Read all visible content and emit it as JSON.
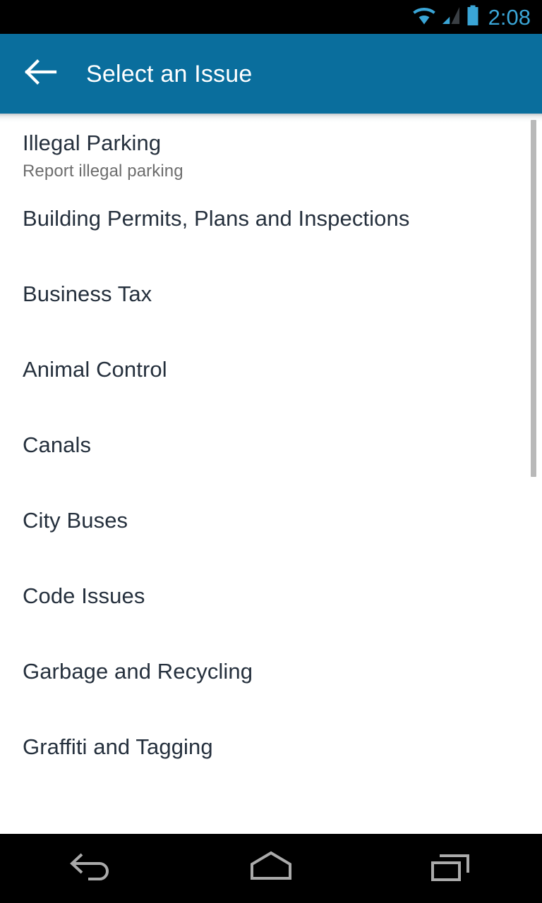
{
  "status_bar": {
    "time": "2:08",
    "icons": [
      {
        "name": "wifi-icon",
        "label": "wifi"
      },
      {
        "name": "cellular-signal-icon",
        "label": "signal"
      },
      {
        "name": "battery-icon",
        "label": "battery"
      }
    ],
    "colors": {
      "background": "#000000",
      "accent": "#3aa5d6",
      "signal_dim": "#3a3f44"
    }
  },
  "app_bar": {
    "title": "Select an Issue",
    "back_icon": "arrow-left-icon",
    "colors": {
      "background": "#0a6e9d",
      "text": "#ffffff"
    }
  },
  "list": {
    "items": [
      {
        "title": "Illegal Parking",
        "subtitle": "Report illegal parking"
      },
      {
        "title": "Building Permits, Plans and Inspections",
        "subtitle": ""
      },
      {
        "title": "Business Tax",
        "subtitle": ""
      },
      {
        "title": "Animal Control",
        "subtitle": ""
      },
      {
        "title": "Canals",
        "subtitle": ""
      },
      {
        "title": "City Buses",
        "subtitle": ""
      },
      {
        "title": "Code Issues",
        "subtitle": ""
      },
      {
        "title": "Garbage and Recycling",
        "subtitle": ""
      },
      {
        "title": "Graffiti and Tagging",
        "subtitle": ""
      }
    ],
    "colors": {
      "background": "#ffffff",
      "title": "#25303d",
      "subtitle": "#6d6d6d",
      "scrollbar": "#b9b9b9"
    }
  },
  "nav_bar": {
    "buttons": [
      {
        "name": "nav-back-button",
        "icon": "back-arrow-icon"
      },
      {
        "name": "nav-home-button",
        "icon": "home-icon"
      },
      {
        "name": "nav-recents-button",
        "icon": "recents-icon"
      }
    ],
    "colors": {
      "background": "#000000",
      "icon": "#aaaaaa"
    }
  }
}
